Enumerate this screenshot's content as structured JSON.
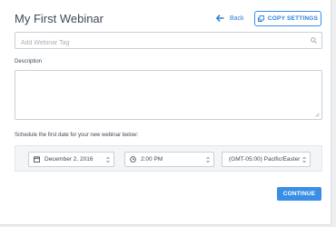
{
  "header": {
    "title": "My First Webinar",
    "back_label": "Back",
    "copy_settings_label": "COPY SETTINGS"
  },
  "tag_input": {
    "placeholder": "Add Webinar Tag",
    "value": ""
  },
  "description": {
    "label": "Description",
    "value": ""
  },
  "schedule": {
    "label": "Schedule the first date for your new webinar below:",
    "date": "December 2, 2016",
    "time": "2:00 PM",
    "timezone": "(GMT-05:00) Pacific/Easter"
  },
  "footer": {
    "continue_label": "CONTINUE"
  },
  "icons": {
    "back": "arrow-left-icon",
    "copy": "copy-icon",
    "search": "search-icon",
    "date": "calendar-icon",
    "time": "clock-icon",
    "select": "chevron-updown-icon"
  },
  "colors": {
    "accent": "#3a8ee6",
    "text": "#3d4a56",
    "background": "#eceef0"
  }
}
